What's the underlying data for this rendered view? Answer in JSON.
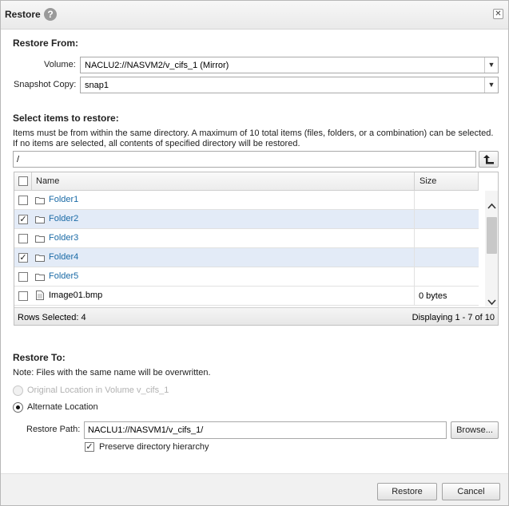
{
  "dialog": {
    "title": "Restore",
    "help_glyph": "?",
    "close_glyph": "✕"
  },
  "restore_from": {
    "heading": "Restore From:",
    "volume_label": "Volume:",
    "volume_value": "NACLU2://NASVM2/v_cifs_1 (Mirror)",
    "snapshot_label": "Snapshot Copy:",
    "snapshot_value": "snap1"
  },
  "select_items": {
    "heading": "Select items to restore:",
    "note1": "Items must be from within the same directory. A maximum of 10 total items (files, folders, or a combination) can be selected.",
    "note2": "If no items are selected, all contents of specified directory will be restored.",
    "path_value": "/",
    "up_glyph": "⮤"
  },
  "grid": {
    "col_name": "Name",
    "col_size": "Size",
    "rows": [
      {
        "name": "Folder1",
        "type": "folder",
        "size": "",
        "checked": false
      },
      {
        "name": "Folder2",
        "type": "folder",
        "size": "",
        "checked": true
      },
      {
        "name": "Folder3",
        "type": "folder",
        "size": "",
        "checked": false
      },
      {
        "name": "Folder4",
        "type": "folder",
        "size": "",
        "checked": true
      },
      {
        "name": "Folder5",
        "type": "folder",
        "size": "",
        "checked": false
      },
      {
        "name": "Image01.bmp",
        "type": "file",
        "size": "0 bytes",
        "checked": false
      }
    ],
    "rows_selected": "Rows Selected: 4",
    "displaying": "Displaying 1 - 7 of 10"
  },
  "restore_to": {
    "heading": "Restore To:",
    "note": "Note: Files with the same name will be overwritten.",
    "option_original": "Original Location in Volume v_cifs_1",
    "option_alternate": "Alternate Location",
    "path_label": "Restore Path:",
    "path_value": "NACLU1://NASVM1/v_cifs_1/",
    "browse_label": "Browse...",
    "preserve_label": "Preserve directory hierarchy"
  },
  "footer": {
    "restore_label": "Restore",
    "cancel_label": "Cancel"
  },
  "colors": {
    "link": "#1a6aa6",
    "selected_row": "#e3ebf7"
  }
}
